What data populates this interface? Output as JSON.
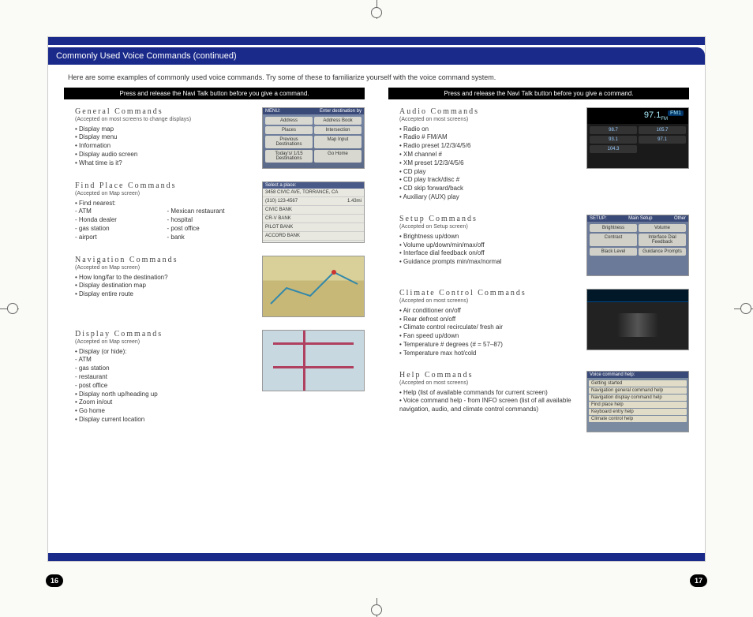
{
  "page_title": "Commonly Used Voice Commands (continued)",
  "intro": "Here are some examples of commonly used voice commands. Try some of these to familiarize yourself with the voice command system.",
  "header_bar": "Press and release the Navi Talk button before you give a command.",
  "page_left": "16",
  "page_right": "17",
  "left": {
    "general": {
      "title": "General Commands",
      "note": "(Accepted on most screens to change displays)",
      "items": [
        "Display map",
        "Display menu",
        "Information",
        "Display audio screen",
        "What time is it?"
      ]
    },
    "find": {
      "title": "Find Place Commands",
      "note": "(Accepted on Map screen)",
      "lead": "Find nearest:",
      "sub": [
        "ATM",
        "Honda dealer",
        "gas station",
        "airport",
        "Mexican restaurant",
        "hospital",
        "post office",
        "bank"
      ]
    },
    "nav": {
      "title": "Navigation Commands",
      "note": "(Accepted on Map screen)",
      "items": [
        "How long/far to the destination?",
        "Display destination map",
        "Display entire route"
      ]
    },
    "disp": {
      "title": "Display Commands",
      "note": "(Accepted on Map screen)",
      "lead": "Display (or hide):",
      "sub": [
        "ATM",
        "gas station",
        "restaurant",
        "post office"
      ],
      "items2": [
        "Display north up/heading up",
        "Zoom in/out",
        "Go home",
        "Display current location"
      ]
    }
  },
  "right": {
    "audio": {
      "title": "Audio Commands",
      "note": "(Accepted on most screens)",
      "items": [
        "Radio on",
        "Radio # FM/AM",
        "Radio preset 1/2/3/4/5/6",
        "XM channel #",
        "XM preset 1/2/3/4/5/6",
        "CD play",
        "CD play track/disc #",
        "CD skip forward/back",
        "Auxiliary (AUX) play"
      ]
    },
    "setup": {
      "title": "Setup Commands",
      "note": "(Accepted on Setup screen)",
      "items": [
        "Brightness up/down",
        "Volume up/down/min/max/off",
        "Interface dial feedback on/off",
        "Guidance prompts min/max/normal"
      ]
    },
    "climate": {
      "title": "Climate Control Commands",
      "note": "(Accepted on most screens)",
      "items": [
        "Air conditioner on/off",
        "Rear defrost on/off",
        "Climate control recirculate/ fresh air",
        "Fan speed up/down",
        "Temperature # degrees (# = 57–87)",
        "Temperature max hot/cold"
      ]
    },
    "help": {
      "title": "Help Commands",
      "note": "(Accepted on most screens)",
      "items": [
        "Help (list of available commands for current screen)",
        "Voice command help - from INFO screen (list of all available navigation, audio, and climate control commands)"
      ]
    }
  },
  "screens": {
    "menu": {
      "bar": "MENU:",
      "bar2": "Enter destination by",
      "btns": [
        "Address",
        "Address Book",
        "Places",
        "Intersection",
        "Previous Destinations",
        "Map Input",
        "Today's/ 1/15 Destinations",
        "Go Home"
      ]
    },
    "place": {
      "hdr": "Select a place:",
      "addr": "3458 CIVIC AVE, TORRANCE, CA",
      "phone": "(310) 123-4567",
      "dist": "1.43mi",
      "rows": [
        "CIVIC BANK",
        "CR-V BANK",
        "PILOT BANK",
        "ACCORD BANK"
      ]
    },
    "radio": {
      "freq": "97.1",
      "band": "FM1",
      "presets": [
        "98.7",
        "105.7",
        "93.1",
        "97.1",
        "104.3"
      ]
    },
    "setup": {
      "bar": "SETUP:",
      "mid": "Main Setup",
      "right": "Other",
      "btns": [
        "Brightness",
        "Volume",
        "Contrast",
        "Interface Dial Feedback",
        "Black Level",
        "Guidance Prompts"
      ]
    },
    "help": {
      "bar": "Voice command help:",
      "rows": [
        "Getting started",
        "Navigation general command help",
        "Navigation display command help",
        "Find place help",
        "Keyboard entry help",
        "Climate control help"
      ]
    }
  }
}
